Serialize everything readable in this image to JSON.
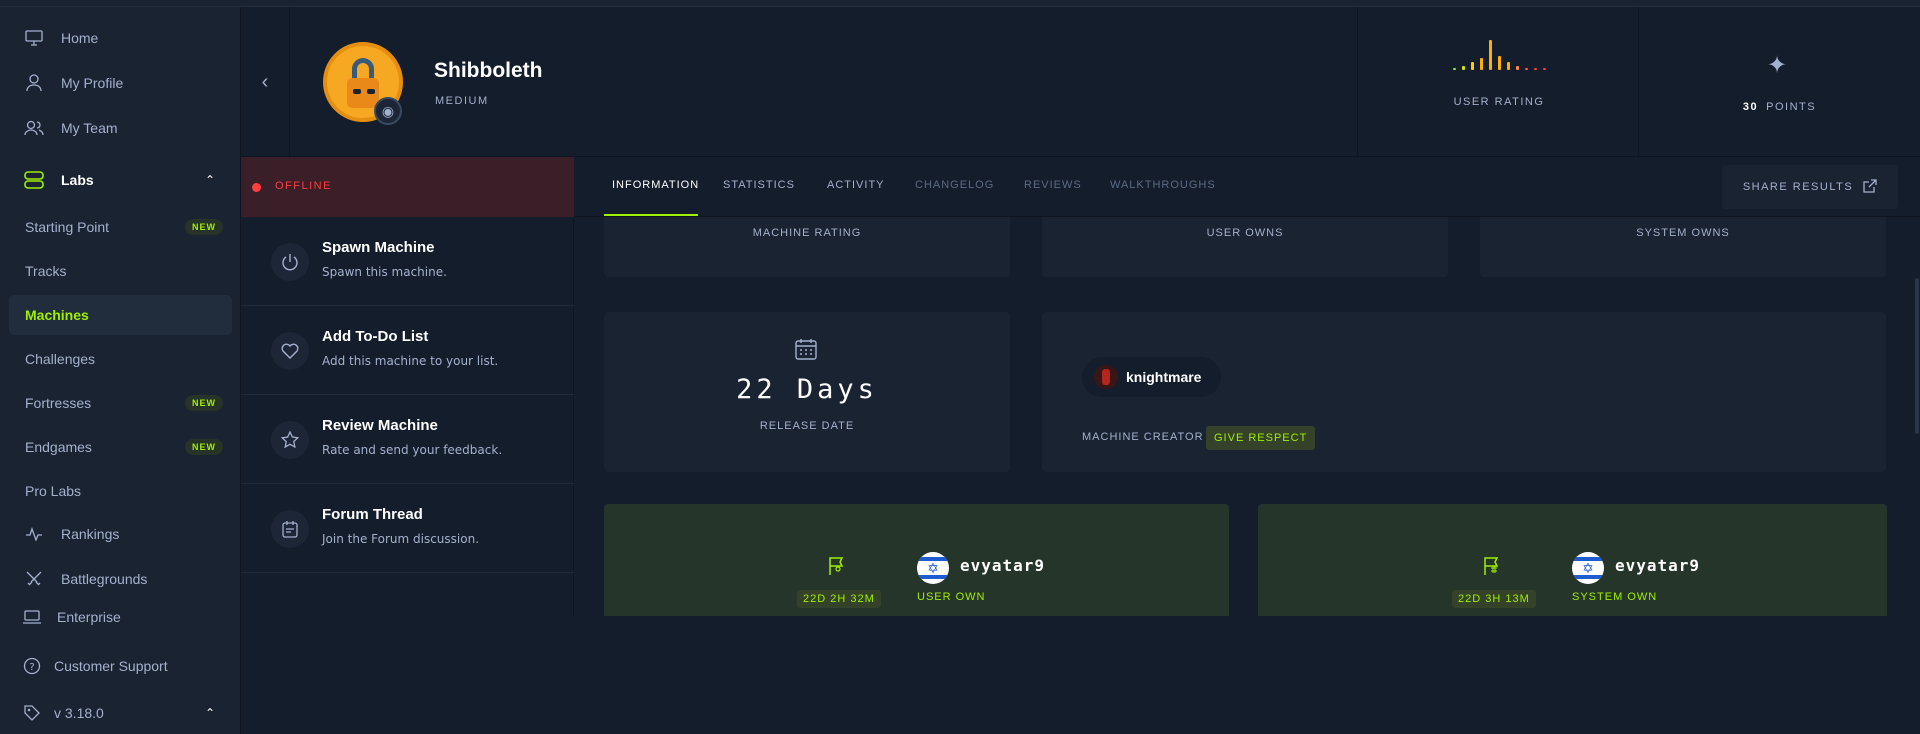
{
  "sidebar": {
    "items": [
      {
        "label": "Home",
        "icon": "monitor-icon"
      },
      {
        "label": "My Profile",
        "icon": "user-icon"
      },
      {
        "label": "My Team",
        "icon": "users-icon"
      }
    ],
    "labs": {
      "label": "Labs",
      "icon": "labs-icon"
    },
    "labs_items": [
      {
        "label": "Starting Point",
        "badge": "NEW"
      },
      {
        "label": "Tracks",
        "badge": ""
      },
      {
        "label": "Machines",
        "badge": ""
      },
      {
        "label": "Challenges",
        "badge": ""
      },
      {
        "label": "Fortresses",
        "badge": "NEW"
      },
      {
        "label": "Endgames",
        "badge": "NEW"
      },
      {
        "label": "Pro Labs",
        "badge": ""
      }
    ],
    "rankings": "Rankings",
    "battlegrounds": "Battlegrounds",
    "enterprise": "Enterprise",
    "support": "Customer Support",
    "version": "v 3.18.0"
  },
  "machine": {
    "name": "Shibboleth",
    "difficulty": "MEDIUM",
    "rating_label": "USER RATING",
    "points_value": "30",
    "points_label": "POINTS",
    "status": "OFFLINE"
  },
  "actions": [
    {
      "title": "Spawn Machine",
      "desc": "Spawn this machine."
    },
    {
      "title": "Add To-Do List",
      "desc": "Add this machine to your list."
    },
    {
      "title": "Review Machine",
      "desc": "Rate and send your feedback."
    },
    {
      "title": "Forum Thread",
      "desc": "Join the Forum discussion."
    }
  ],
  "tabs": [
    "INFORMATION",
    "STATISTICS",
    "ACTIVITY",
    "CHANGELOG",
    "REVIEWS",
    "WALKTHROUGHS"
  ],
  "share_label": "SHARE RESULTS",
  "stats_labels": [
    "MACHINE RATING",
    "USER OWNS",
    "SYSTEM OWNS"
  ],
  "release": {
    "value": "22 Days",
    "label": "RELEASE DATE"
  },
  "creator": {
    "name": "knightmare",
    "label": "MACHINE CREATOR",
    "button": "GIVE RESPECT"
  },
  "owns": [
    {
      "time": "22D 2H 32M",
      "user": "evyatar9",
      "type": "USER OWN"
    },
    {
      "time": "22D 3H 13M",
      "user": "evyatar9",
      "type": "SYSTEM OWN"
    }
  ],
  "colors": {
    "accent": "#9fef00",
    "offline": "#ff3e3e",
    "background": "#141d2b",
    "panel": "#1a2332"
  }
}
